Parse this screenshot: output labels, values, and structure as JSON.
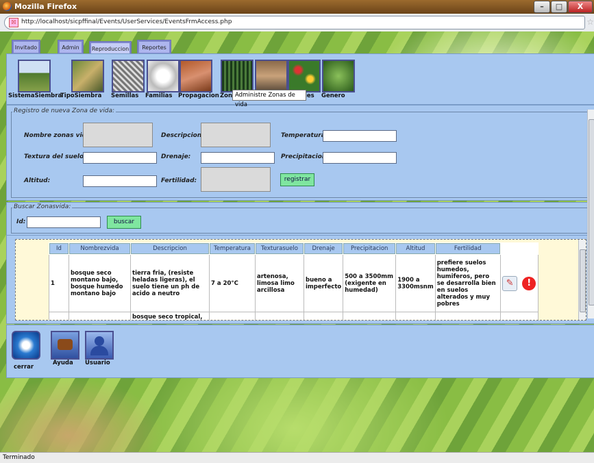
{
  "window": {
    "title": "Mozilla Firefox",
    "controls": [
      "–",
      "□",
      "X"
    ]
  },
  "browser": {
    "url": "http://localhost/sicpffinal/Events/UserServices/EventsFrmAccess.php",
    "status": "Terminado"
  },
  "tabs": [
    "Invitado",
    "Admin",
    "Reproduccion",
    "Reportes"
  ],
  "modules": [
    {
      "label": "SistemaSiembra",
      "icon": "tree-field-icon"
    },
    {
      "label": "TipoSiembra",
      "icon": "farmer-icon"
    },
    {
      "label": "Semillas",
      "icon": "seeds-icon"
    },
    {
      "label": "Familias",
      "icon": "plant-family-icon"
    },
    {
      "label": "Propagacion",
      "icon": "soil-icon"
    },
    {
      "label": "Zonas",
      "icon": "forest-zone-icon"
    },
    {
      "label": "",
      "icon": "truck-icon"
    },
    {
      "label": "ies",
      "icon": "species-icon"
    },
    {
      "label": "Genero",
      "icon": "genus-icon"
    }
  ],
  "tooltip": "Administre Zonas de vida",
  "form": {
    "legend": "Registro de nueva Zona de vida:",
    "nombre_label": "Nombre zonas vida:",
    "descripcion_label": "Descripcion:",
    "temperatura_label": "Temperatura:",
    "textura_label": "Textura del suelo:",
    "drenaje_label": "Drenaje:",
    "precipitacion_label": "Precipitacion:",
    "altitud_label": "Altitud:",
    "fertilidad_label": "Fertilidad:",
    "submit": "registrar"
  },
  "search": {
    "legend": "Buscar Zonasvida:",
    "id_label": "Id:",
    "button": "buscar"
  },
  "table": {
    "headers": [
      "Id",
      "Nombrezvida",
      "Descripcion",
      "Temperatura",
      "Texturasuelo",
      "Drenaje",
      "Precipitacion",
      "Altitud",
      "Fertilidad"
    ],
    "rows": [
      [
        "1",
        "bosque seco montano bajo, bosque humedo montano bajo",
        "tierra fria, (resiste heladas ligeras), el suelo tiene un ph de acido a neutro",
        "7 a 20°C",
        "artenosa, limosa limo arcillosa",
        "bueno a imperfecto",
        "500 a 3500mm (exigente en humedad)",
        "1900 a 3300msnm",
        "prefiere suelos humedos, humiferos, pero se desarrolla bien en suelos alterados y muy pobres"
      ],
      [
        "",
        "",
        "bosque seco tropical,",
        "",
        "",
        "",
        "",
        "",
        ""
      ]
    ]
  },
  "footer": [
    "cerrar",
    "Ayuda",
    "Usuario"
  ]
}
